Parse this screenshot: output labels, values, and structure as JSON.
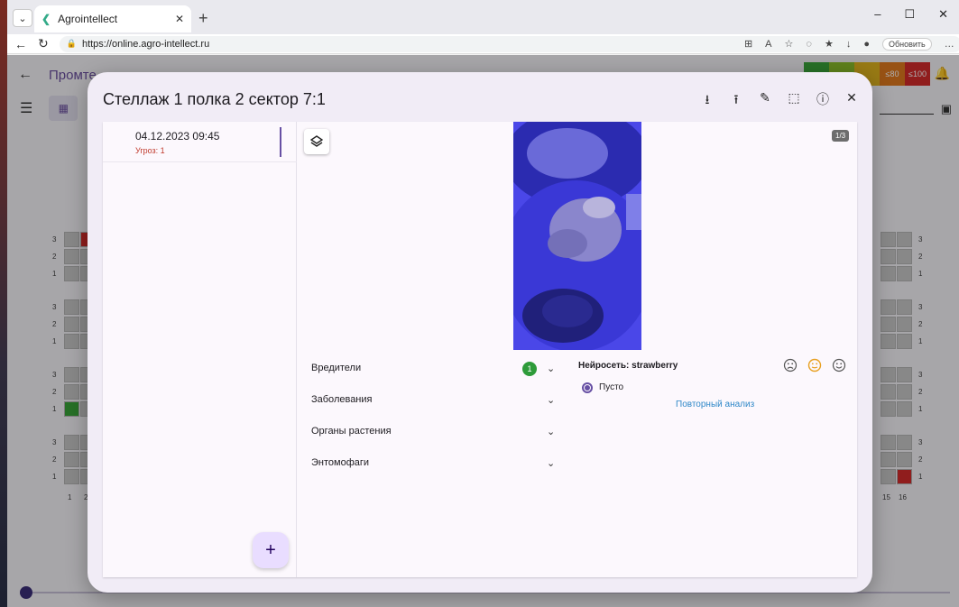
{
  "browser": {
    "tab_title": "Agrointellect",
    "url": "https://online.agro-intellect.ru",
    "update_label": "Обновить"
  },
  "app": {
    "title": "Промте",
    "legend": [
      {
        "label": "",
        "color": "#3aa63a"
      },
      {
        "label": "",
        "color": "#8bbf2a"
      },
      {
        "label": "",
        "color": "#e0b41e"
      },
      {
        "label": "≤80",
        "color": "#e07a1e"
      },
      {
        "label": "≤100",
        "color": "#d42b2b"
      }
    ],
    "row_labels": [
      "3",
      "2",
      "1"
    ],
    "col_labels_left": [
      "1",
      "2"
    ],
    "col_labels_right": [
      "15",
      "16"
    ]
  },
  "modal": {
    "title": "Стеллаж 1 полка 2 сектор 7:1",
    "entry": {
      "date": "04.12.2023 09:45",
      "threats": "Угроз: 1"
    },
    "page_badge": "1/3",
    "categories": [
      {
        "label": "Вредители",
        "count": "1"
      },
      {
        "label": "Заболевания"
      },
      {
        "label": "Органы растения"
      },
      {
        "label": "Энтомофаги"
      }
    ],
    "neural": {
      "title": "Нейросеть: strawberry",
      "option": "Пусто",
      "reanalyze": "Повторный анализ"
    },
    "colors": {
      "accent": "#6750a4",
      "threat": "#c0392b",
      "count_badge": "#2e9b3a",
      "link": "#2f88c8"
    }
  }
}
